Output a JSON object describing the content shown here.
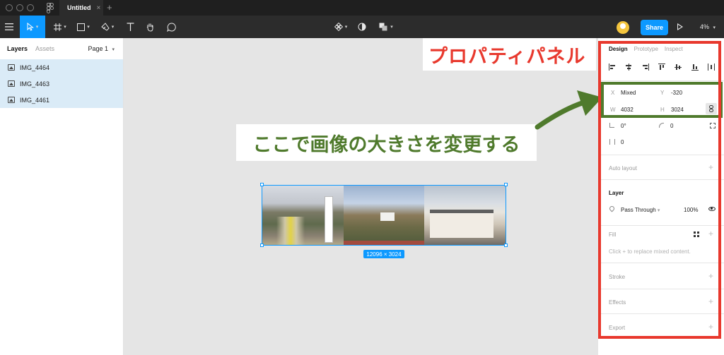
{
  "titlebar": {
    "tab_title": "Untitled",
    "tab_close": "×",
    "new_tab": "+"
  },
  "toolbar": {
    "share_label": "Share",
    "zoom": "4%"
  },
  "left_panel": {
    "tab_layers": "Layers",
    "tab_assets": "Assets",
    "page": "Page 1",
    "layers": [
      {
        "name": "IMG_4464"
      },
      {
        "name": "IMG_4463"
      },
      {
        "name": "IMG_4461"
      }
    ]
  },
  "canvas": {
    "callout_properties": "プロパティパネル",
    "callout_resize": "ここで画像の大きさを変更する",
    "dimensions": "12096 × 3024"
  },
  "right_panel": {
    "tab_design": "Design",
    "tab_prototype": "Prototype",
    "tab_inspect": "Inspect",
    "x_label": "X",
    "x_value": "Mixed",
    "y_label": "Y",
    "y_value": "-320",
    "w_label": "W",
    "w_value": "4032",
    "h_label": "H",
    "h_value": "3024",
    "rotation": "0°",
    "radius": "0",
    "spacing": "0",
    "auto_layout": "Auto layout",
    "layer_title": "Layer",
    "blend_mode": "Pass Through",
    "opacity": "100%",
    "fill_title": "Fill",
    "fill_hint": "Click + to replace mixed content.",
    "stroke_title": "Stroke",
    "effects_title": "Effects",
    "export_title": "Export",
    "plus": "+"
  },
  "colors": {
    "accent": "#0d99ff",
    "callout_red": "#e8382d",
    "callout_green": "#4f7a2c"
  }
}
